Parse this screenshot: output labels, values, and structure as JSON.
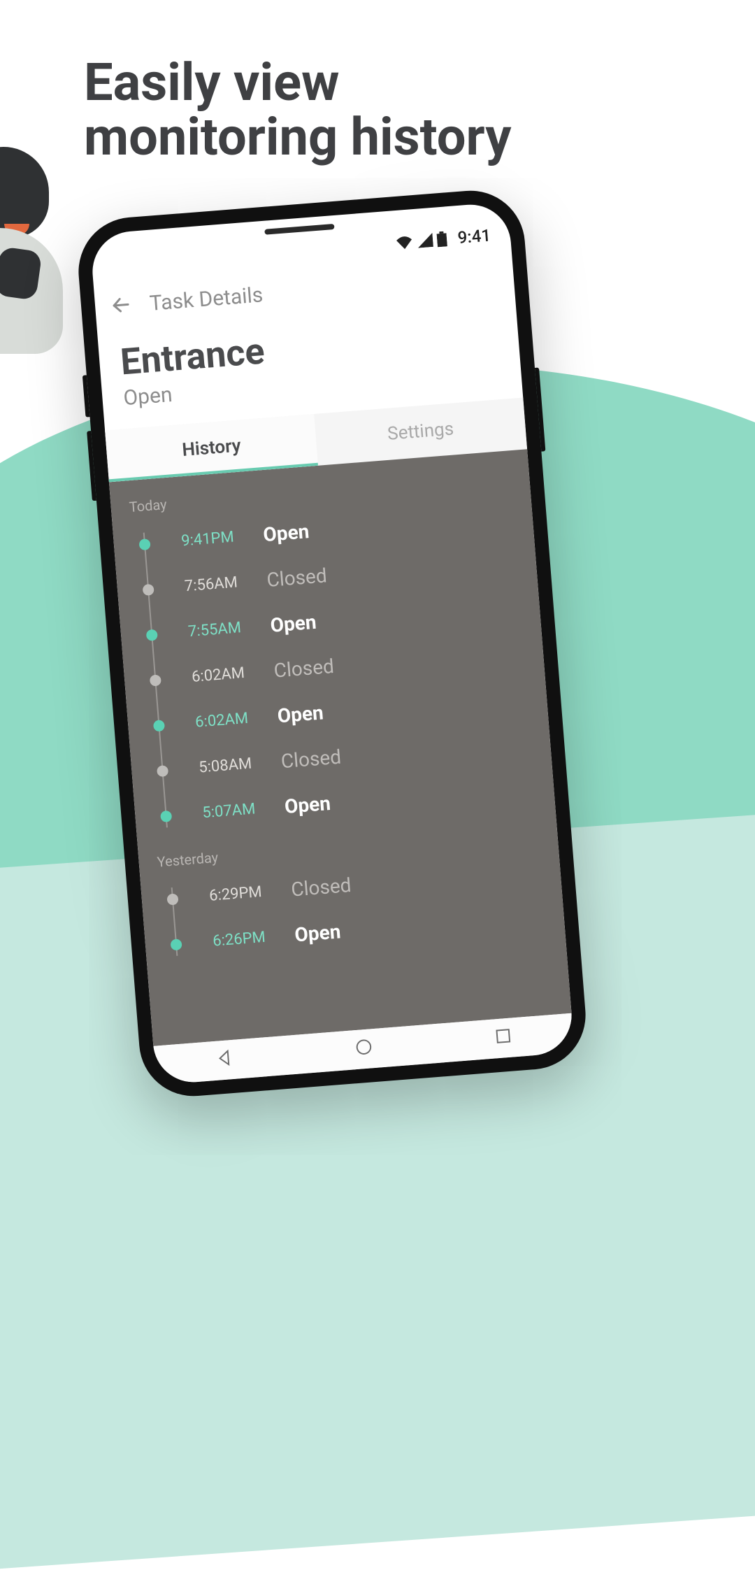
{
  "marketing": {
    "title_line1": "Easily view",
    "title_line2": "monitoring history"
  },
  "status_bar": {
    "time": "9:41"
  },
  "header": {
    "title": "Task Details"
  },
  "page": {
    "title": "Entrance",
    "subtitle": "Open"
  },
  "tabs": {
    "history": "History",
    "settings": "Settings"
  },
  "sections": {
    "today": "Today",
    "yesterday": "Yesterday"
  },
  "events_today": [
    {
      "time": "9:41PM",
      "state": "Open",
      "open": true
    },
    {
      "time": "7:56AM",
      "state": "Closed",
      "open": false
    },
    {
      "time": "7:55AM",
      "state": "Open",
      "open": true
    },
    {
      "time": "6:02AM",
      "state": "Closed",
      "open": false
    },
    {
      "time": "6:02AM",
      "state": "Open",
      "open": true
    },
    {
      "time": "5:08AM",
      "state": "Closed",
      "open": false
    },
    {
      "time": "5:07AM",
      "state": "Open",
      "open": true
    }
  ],
  "events_yesterday": [
    {
      "time": "6:29PM",
      "state": "Closed",
      "open": false
    },
    {
      "time": "6:26PM",
      "state": "Open",
      "open": true
    }
  ],
  "colors": {
    "accent": "#68cbb0",
    "panel": "#6e6b68"
  }
}
